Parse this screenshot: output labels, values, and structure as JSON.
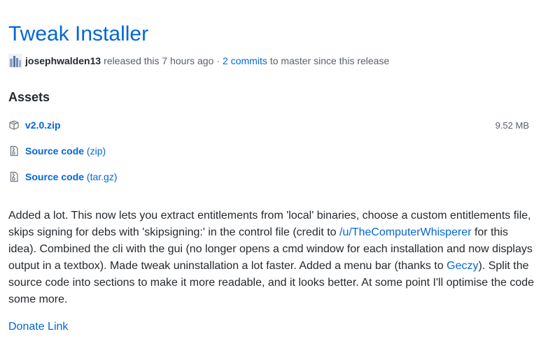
{
  "release": {
    "title": "Tweak Installer",
    "author": "josephwalden13",
    "released_text": "released this 7 hours ago",
    "separator": "·",
    "commits_link": "2 commits",
    "commits_suffix": "to master since this release"
  },
  "assets": {
    "heading": "Assets",
    "items": [
      {
        "name": "v2.0.zip",
        "size": "9.52 MB",
        "icon": "package-icon"
      },
      {
        "name": "Source code",
        "format": "(zip)",
        "icon": "file-zip-icon"
      },
      {
        "name": "Source code",
        "format": "(tar.gz)",
        "icon": "file-zip-icon"
      }
    ]
  },
  "notes": {
    "p1": "Added a lot. This now lets you extract entitlements from 'local' binaries, choose a custom entitlements file, skips signing for debs with 'skipsigning:' in the control file (credit to ",
    "link1": "/u/TheComputerWhisperer",
    "p2": " for this idea). Combined the cli with the gui (no longer opens a cmd window for each installation and now displays output in a textbox). Made tweak uninstallation a lot faster. Added a menu bar (thanks to ",
    "link2": "Geczy",
    "p3": "). Split the source code into sections to make it more readable, and it looks better. At some point I'll optimise the code some more.",
    "donate_link": "Donate Link"
  },
  "colors": {
    "link": "#0366d6",
    "text": "#24292e",
    "muted": "#586069"
  }
}
